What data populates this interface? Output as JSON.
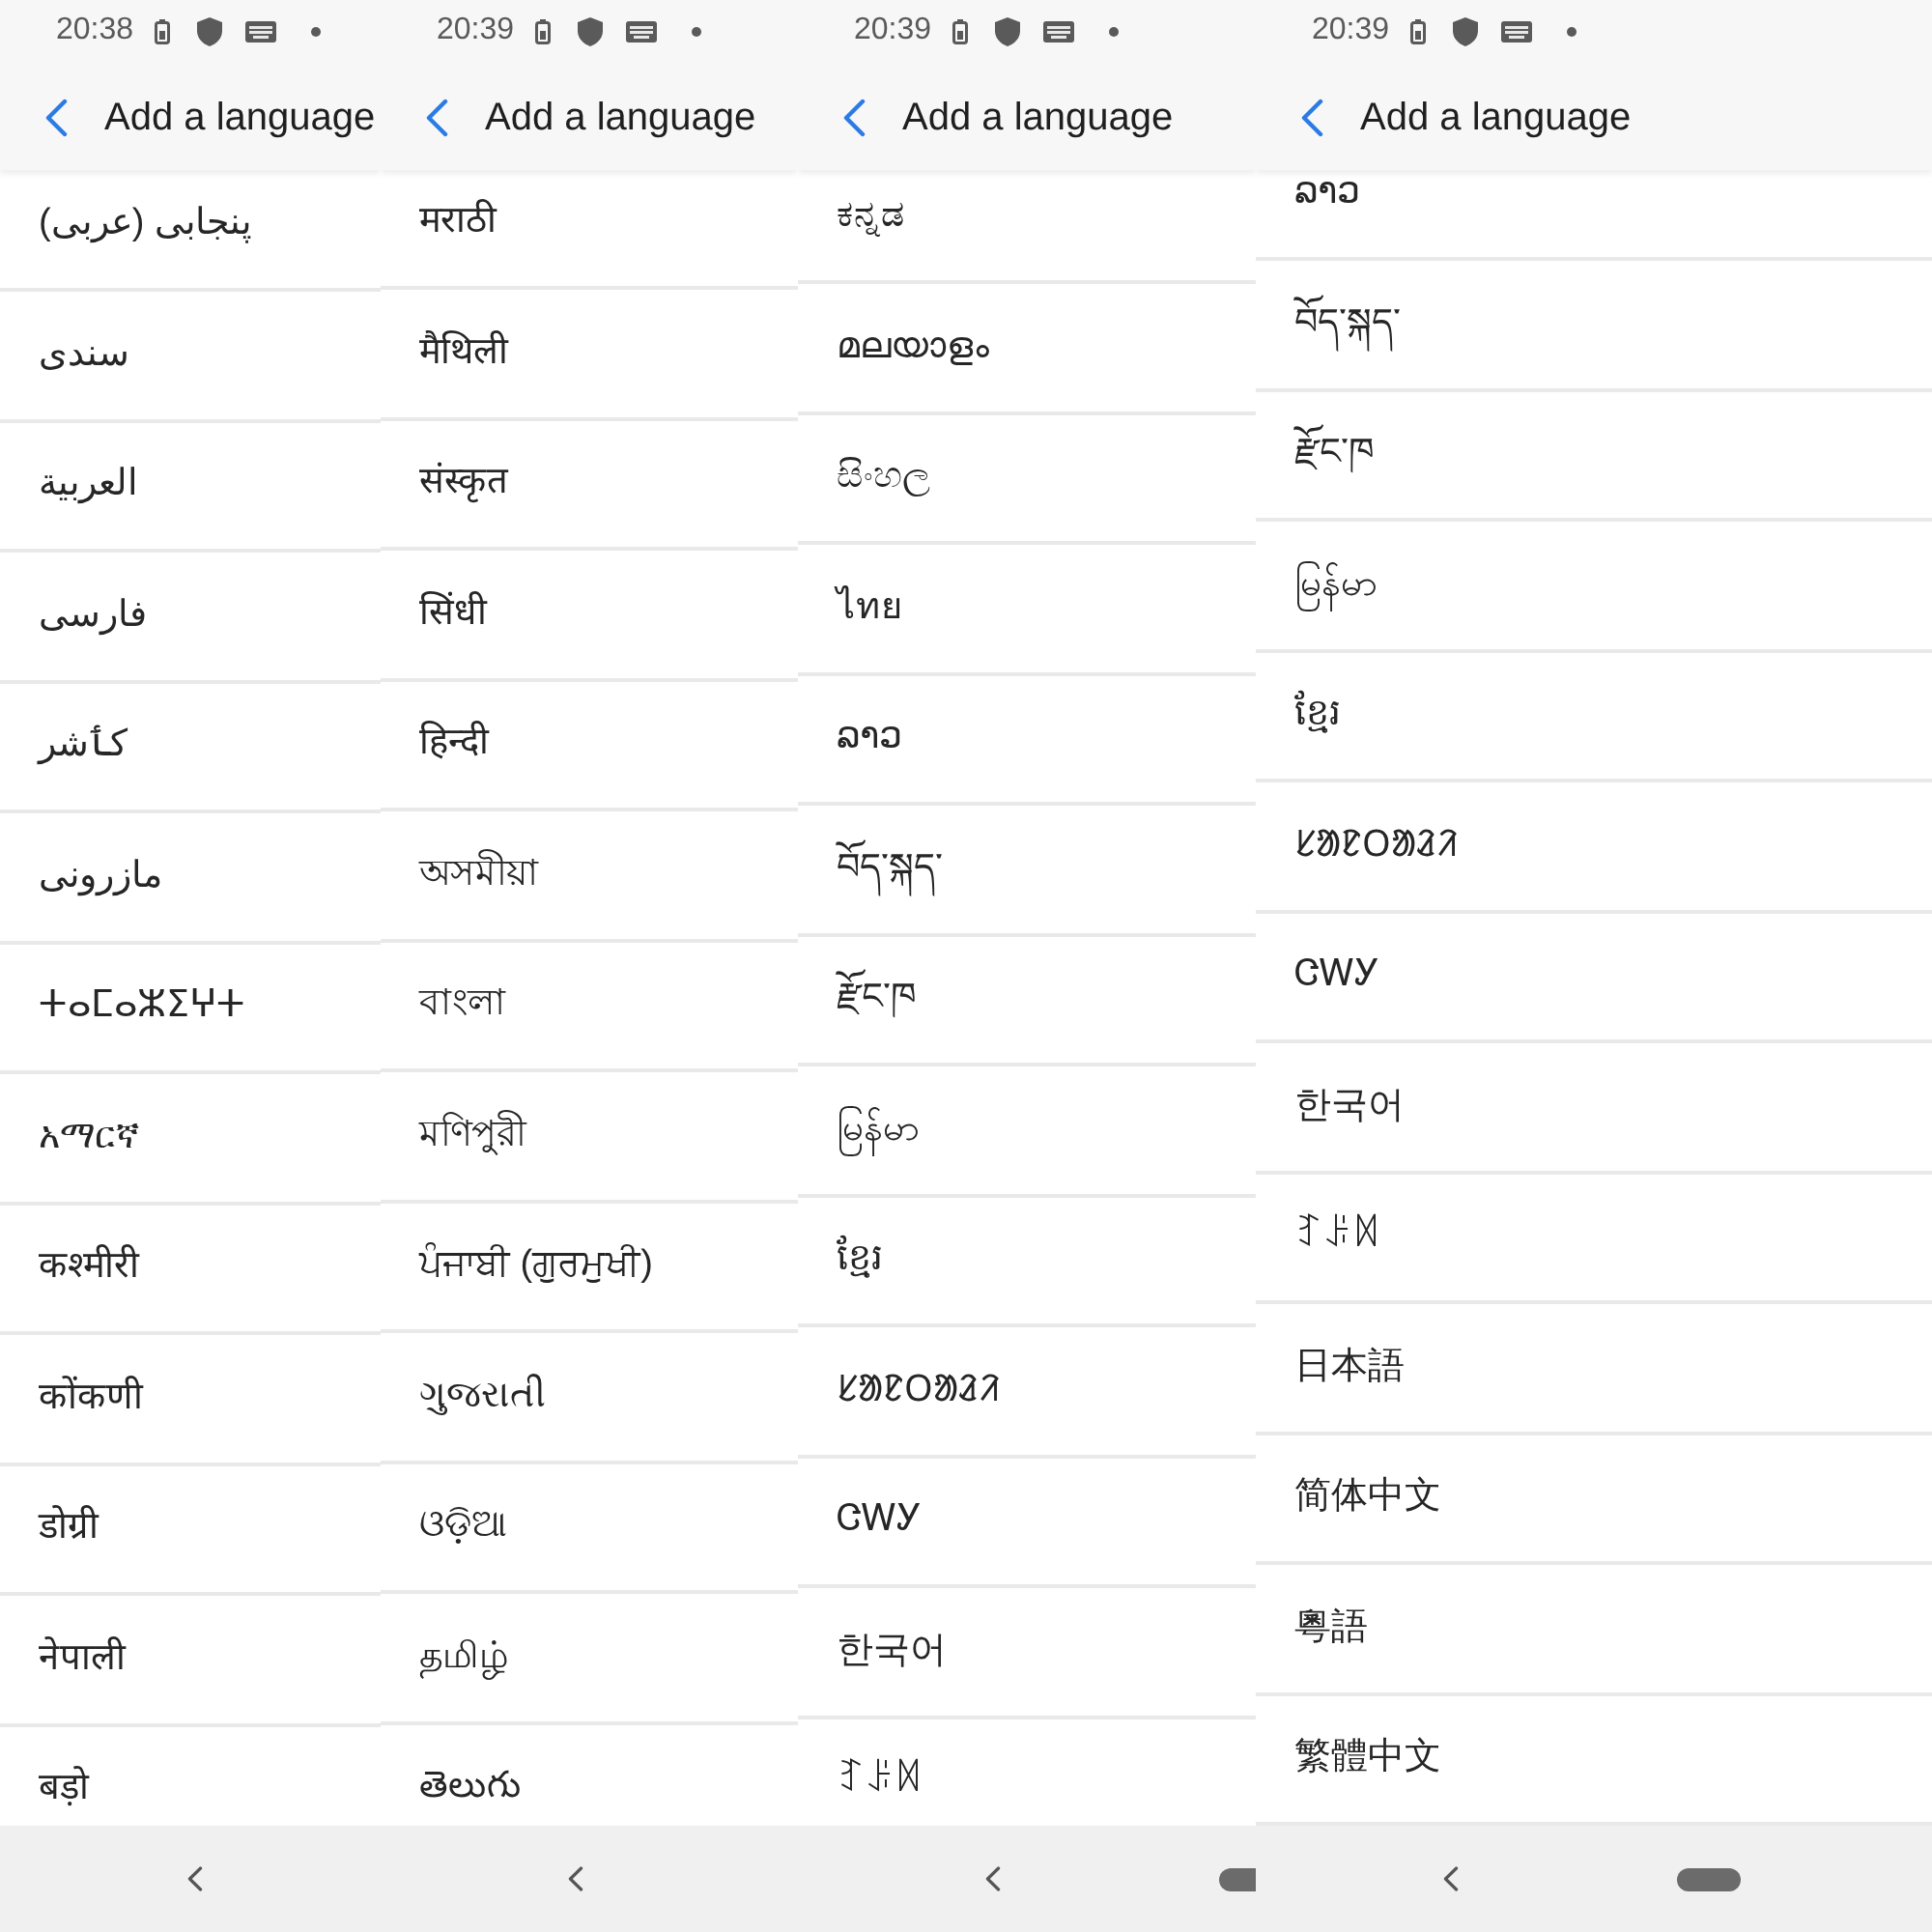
{
  "panels": [
    {
      "status_bar": {
        "time": "20:38"
      },
      "app_bar": {
        "title": "Add a language"
      },
      "languages": [
        "پنجابی (عربی)",
        "سندی",
        "العربية",
        "فارسی",
        "کٲشر",
        "مازرونی",
        "ⵜⴰⵎⴰⵣⵉⵖⵜ",
        "አማርኛ",
        "कश्मीरी",
        "कोंकणी",
        "डोग्री",
        "नेपाली",
        "बड़ो"
      ]
    },
    {
      "status_bar": {
        "time": "20:39"
      },
      "app_bar": {
        "title": "Add a language"
      },
      "languages": [
        "मराठी",
        "मैथिली",
        "संस्कृत",
        "सिंधी",
        "हिन्दी",
        "অসমীয়া",
        "বাংলা",
        "মণিপুরী",
        "ਪੰਜਾਬੀ (ਗੁਰਮੁਖੀ)",
        "ગુજરાતી",
        "ଓଡ଼ିଆ",
        "தமிழ்",
        "తెలుగు"
      ]
    },
    {
      "status_bar": {
        "time": "20:39"
      },
      "app_bar": {
        "title": "Add a language"
      },
      "languages": [
        "ಕನ್ನಡ",
        "മലയാളം",
        "සිංහල",
        "ไทย",
        "ລາວ",
        "བོད་སྐད་",
        "རྫོང་ཁ",
        "မြန်မာ",
        "ខ្មែរ",
        "ᱥᱟᱱᱛᱟᱲᱤ",
        "ᏣᎳᎩ",
        "한국어",
        "ꆈꌠꉙ"
      ]
    },
    {
      "status_bar": {
        "time": "20:39"
      },
      "app_bar": {
        "title": "Add a language"
      },
      "languages": [
        "ລາວ",
        "བོད་སྐད་",
        "རྫོང་ཁ",
        "မြန်မာ",
        "ខ្មែរ",
        "ᱥᱟᱱᱛᱟᱲᱤ",
        "ᏣᎳᎩ",
        "한국어",
        "ꆈꌠꉙ",
        "日本語",
        "简体中文",
        "粵語",
        "繁體中文"
      ]
    }
  ]
}
